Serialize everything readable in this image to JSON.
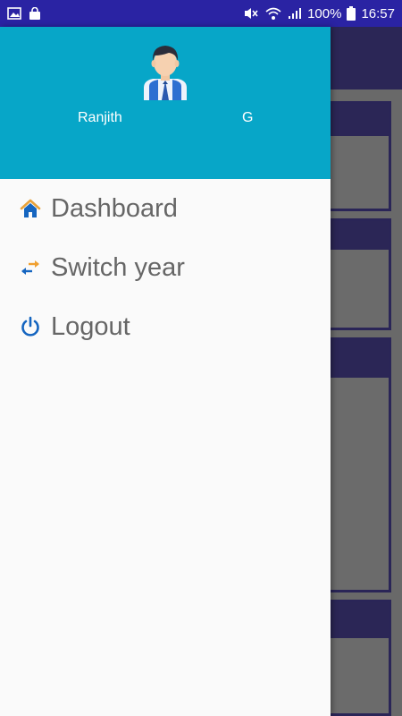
{
  "status_bar": {
    "battery_percent": "100%",
    "time": "16:57",
    "icons": [
      "image-icon",
      "shopping-bag-icon",
      "mute-icon",
      "wifi-icon",
      "signal-icon",
      "battery-icon"
    ]
  },
  "drawer": {
    "user": {
      "first_name": "Ranjith",
      "last_name": "G"
    },
    "menu": [
      {
        "label": "Dashboard",
        "icon": "home-icon"
      },
      {
        "label": "Switch year",
        "icon": "swap-arrows-icon"
      },
      {
        "label": "Logout",
        "icon": "power-icon"
      }
    ]
  },
  "colors": {
    "status_bar": "#2a23a3",
    "drawer_header": "#07a6c8",
    "menu_text": "#666666",
    "home_icon_roof": "#e8a23a",
    "home_icon_body": "#1565c0",
    "swap_icon_left": "#1565c0",
    "swap_icon_right": "#f0a030",
    "power_icon": "#1565c0",
    "background_app_dark": "#2b2656"
  }
}
